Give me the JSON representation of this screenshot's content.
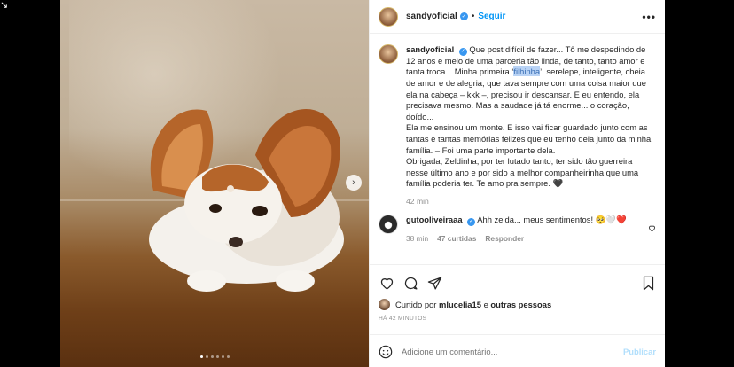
{
  "corner_glyph": "↘",
  "post": {
    "username": "sandyoficial",
    "separator": "•",
    "follow_label": "Seguir",
    "more_label": "•••",
    "next_label": "›",
    "carousel_dots": 6,
    "carousel_active": 0
  },
  "caption": {
    "username": "sandyoficial",
    "text_before": "Que post difícil de fazer... Tô me despedindo de 12 anos e meio de uma parceria tão linda, de tanto, tanto amor e tanta troca... Minha primeira ‘",
    "highlight": "filhinha",
    "text_after": "’, serelepe, inteligente, cheia de amor e de alegria, que tava sempre com uma coisa maior que ela na cabeça – kkk –, precisou ir descansar. E eu entendo, ela precisava mesmo. Mas a saudade já tá enorme... o coração, doído...\nEla me ensinou um monte. E isso vai ficar guardado junto com as tantas e tantas memórias felizes que eu tenho dela junto da minha família. – Foi uma parte importante dela.\nObrigada, Zeldinha, por ter lutado tanto, ter sido tão guerreira nesse último ano e por sido a melhor companheirinha que uma família poderia ter. Te amo pra sempre. 🖤",
    "time": "42 min"
  },
  "comment": {
    "username": "gutooliveiraaa",
    "text": "Ahh zelda... meus sentimentos! 🥺🤍❤️",
    "time": "38 min",
    "likes": "47 curtidas",
    "reply_label": "Responder"
  },
  "likes": {
    "prefix": "Curtido por",
    "user": "mlucelia15",
    "middle": "e",
    "others": "outras pessoas"
  },
  "posted_ago": "HÁ 42 MINUTOS",
  "add_comment": {
    "placeholder": "Adicione um comentário...",
    "publish_label": "Publicar"
  },
  "colors": {
    "accent": "#0095f6",
    "verified": "#3897f0",
    "publish_disabled": "#b2dffc",
    "muted": "#8e8e8e"
  }
}
